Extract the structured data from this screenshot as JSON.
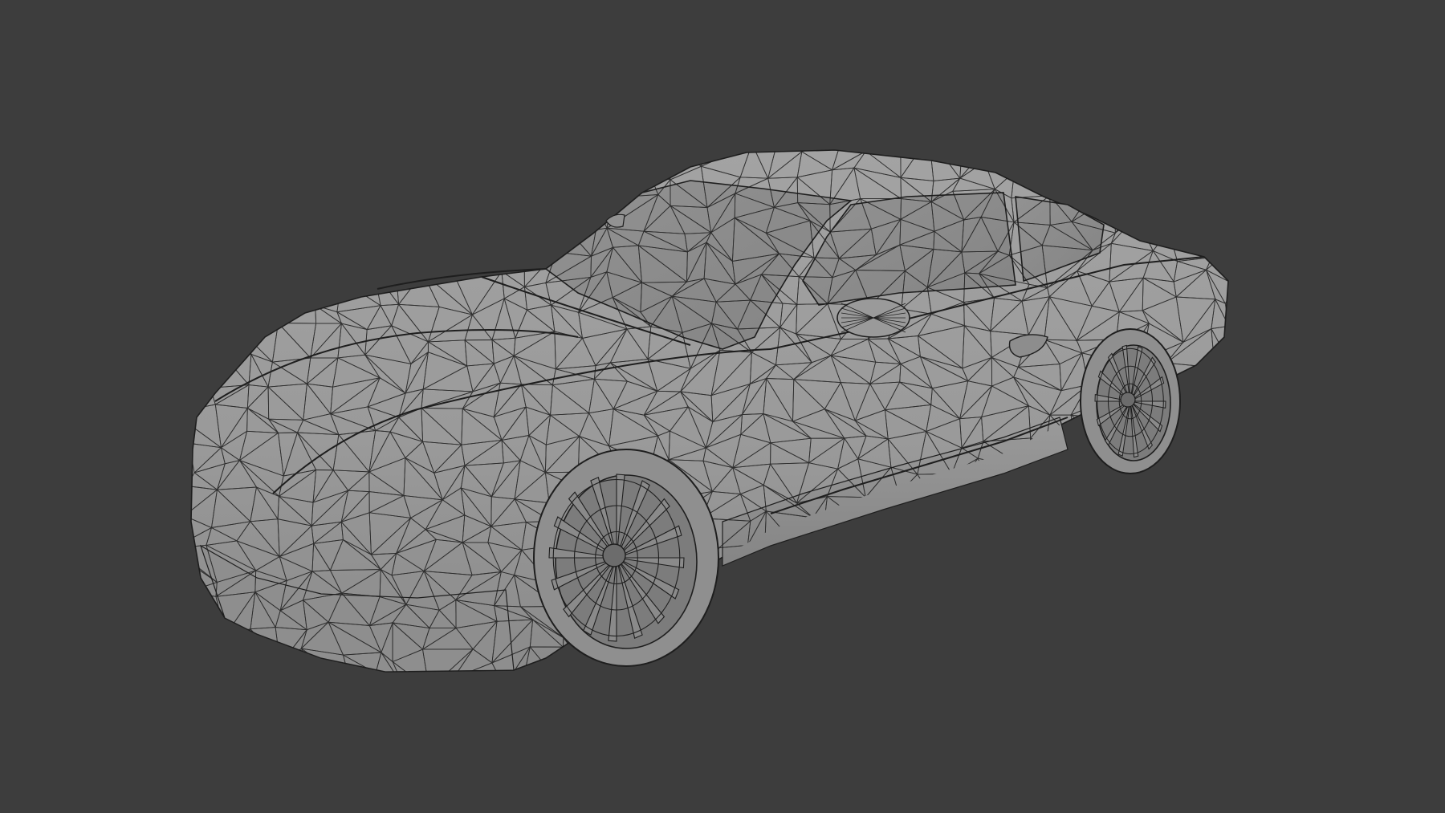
{
  "viewport": {
    "background": "#3d3d3d",
    "shading": "solid-with-wireframe-overlay"
  },
  "model": {
    "subject": "sports-coupe-mesh",
    "surface_color": "#9b9b9b",
    "wire_color": "#1e1e1e",
    "glass_color": "#8a8a8a",
    "wheel_color": "#7c7c7c"
  }
}
